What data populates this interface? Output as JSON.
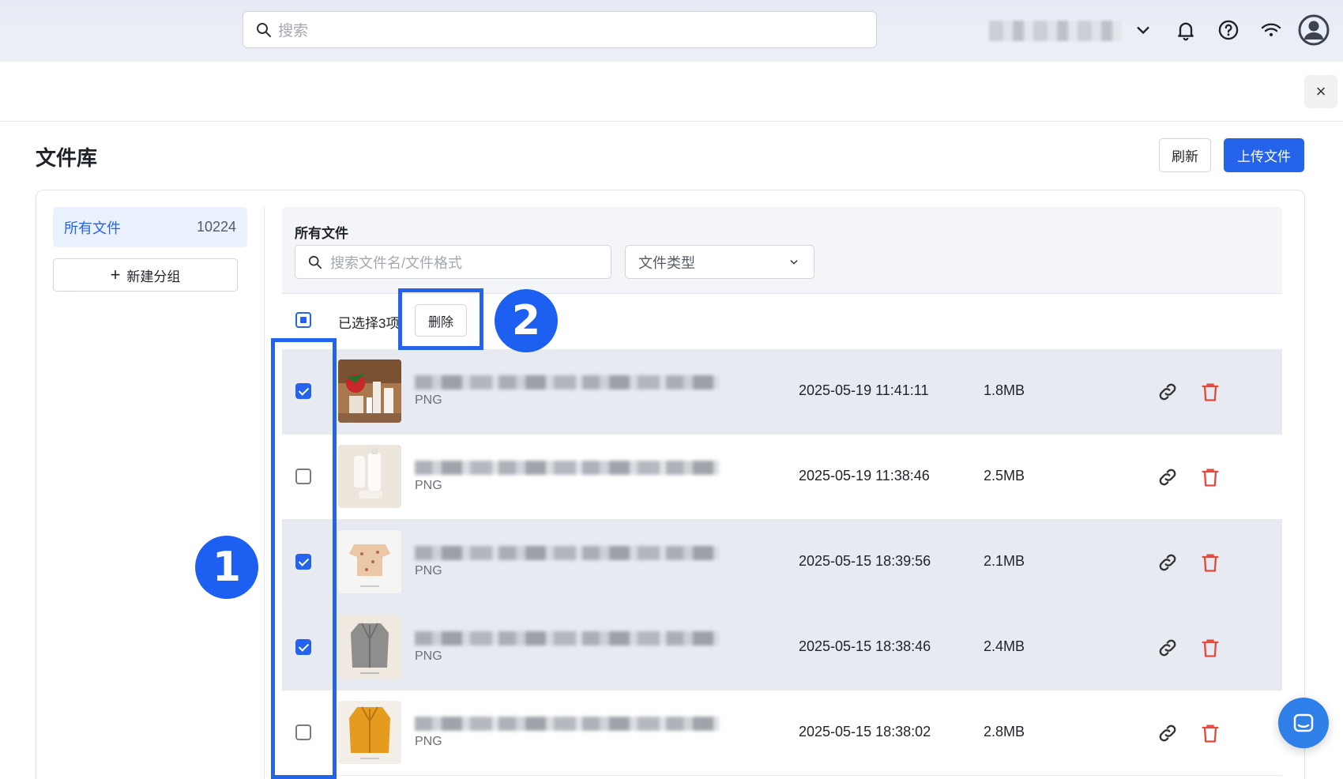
{
  "top": {
    "search_placeholder": "搜索"
  },
  "header": {
    "title": "文件库",
    "refresh_label": "刷新",
    "upload_label": "上传文件",
    "close_label": "×"
  },
  "sidebar": {
    "all_files_label": "所有文件",
    "all_files_count": "10224",
    "new_group_label": "新建分组"
  },
  "filter": {
    "title": "所有文件",
    "search_placeholder": "搜索文件名/文件格式",
    "type_label": "文件类型"
  },
  "selection": {
    "selected_text": "已选择3项",
    "delete_label": "删除"
  },
  "markers": [
    "1",
    "2"
  ],
  "files": [
    {
      "checked": true,
      "format": "PNG",
      "date": "2025-05-19 11:41:11",
      "size": "1.8MB"
    },
    {
      "checked": false,
      "format": "PNG",
      "date": "2025-05-19 11:38:46",
      "size": "2.5MB"
    },
    {
      "checked": true,
      "format": "PNG",
      "date": "2025-05-15 18:39:56",
      "size": "2.1MB"
    },
    {
      "checked": true,
      "format": "PNG",
      "date": "2025-05-15 18:38:46",
      "size": "2.4MB"
    },
    {
      "checked": false,
      "format": "PNG",
      "date": "2025-05-15 18:38:02",
      "size": "2.8MB"
    }
  ],
  "colors": {
    "accent": "#2563eb",
    "danger": "#e5483c",
    "selected_row": "#e7eaf0"
  },
  "icons": [
    "search-icon",
    "chevron-down-icon",
    "bell-icon",
    "help-icon",
    "wifi-icon",
    "avatar-icon",
    "close-icon",
    "plus-icon",
    "link-icon",
    "trash-icon",
    "chat-icon"
  ]
}
